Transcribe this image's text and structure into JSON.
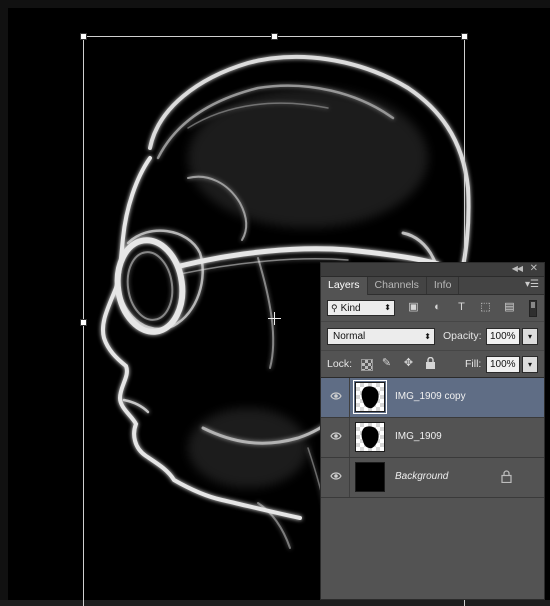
{
  "panel": {
    "tabs": [
      "Layers",
      "Channels",
      "Info"
    ],
    "active_tab": "Layers",
    "collapse_icon": "double-chevron-icon",
    "close_icon": "close-icon",
    "menu_icon": "panel-menu-icon"
  },
  "filter": {
    "kind_label": "Kind",
    "icons": [
      "image-filter-icon",
      "adjustment-filter-icon",
      "type-filter-icon",
      "shape-filter-icon",
      "smart-object-filter-icon"
    ]
  },
  "blend": {
    "mode": "Normal",
    "opacity_label": "Opacity:",
    "opacity_value": "100%"
  },
  "lock": {
    "label": "Lock:",
    "fill_label": "Fill:",
    "fill_value": "100%"
  },
  "layers": [
    {
      "name": "IMG_1909 copy",
      "visible": true,
      "selected": true
    },
    {
      "name": "IMG_1909",
      "visible": true,
      "selected": false
    },
    {
      "name": "Background",
      "visible": true,
      "selected": false,
      "locked": true
    }
  ]
}
